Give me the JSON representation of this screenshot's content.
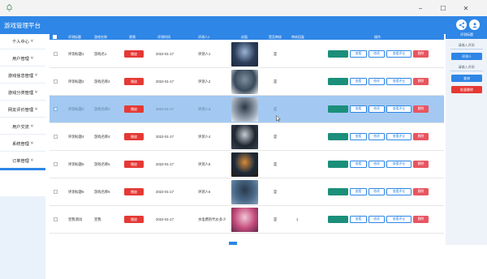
{
  "window": {
    "minimize": "−",
    "maximize": "☐",
    "close": "✕"
  },
  "header": {
    "title": "游戏管理平台"
  },
  "sidebar": {
    "items": [
      {
        "label": "个人中心",
        "arrow": "˅"
      },
      {
        "label": "用户管理",
        "arrow": "˅"
      },
      {
        "label": "游戏信息管理",
        "arrow": "˅"
      },
      {
        "label": "游戏分类管理",
        "arrow": "˅"
      },
      {
        "label": "网友评价管理",
        "arrow": "˅"
      },
      {
        "label": "用户交流",
        "arrow": "˅"
      },
      {
        "label": "系统管理",
        "arrow": "˅"
      },
      {
        "label": "订单管理",
        "arrow": "˅"
      }
    ]
  },
  "table": {
    "columns": [
      "评测标题",
      "游戏名称",
      "视频",
      "评测时间",
      "评测人2",
      "封面",
      "是否审核",
      "审核回复",
      "操作"
    ],
    "rows": [
      {
        "title": "评测标题1",
        "game": "游戏名1",
        "video": "播放",
        "date": "2022-01-17",
        "reviewer": "评测人1",
        "audit": "是",
        "reply": "",
        "cover_colors": [
          "#2b3d5a",
          "#9bb4d6",
          "#1d2738"
        ]
      },
      {
        "title": "评测标题2",
        "game": "游戏名称2",
        "video": "播放",
        "date": "2022-01-17",
        "reviewer": "评测人2",
        "audit": "是",
        "reply": "",
        "cover_colors": [
          "#394a5c",
          "#7d8e9e",
          "#f0f0f0"
        ]
      },
      {
        "title": "评测标题3",
        "game": "游戏名称3",
        "video": "播放",
        "date": "2022-01-17",
        "reviewer": "评测人3",
        "audit": "是",
        "reply": "",
        "cover_colors": [
          "#8e9aa8",
          "#2c3846",
          "#e6ebf2"
        ]
      },
      {
        "title": "评测标题4",
        "game": "游戏名称4",
        "video": "播放",
        "date": "2022-01-17",
        "reviewer": "评测人4",
        "audit": "是",
        "reply": "",
        "cover_colors": [
          "#1e2630",
          "#c8cdd4",
          "#3a4452"
        ]
      },
      {
        "title": "评测标题5",
        "game": "游戏名称5",
        "video": "播放",
        "date": "2022-01-17",
        "reviewer": "评测人5",
        "audit": "是",
        "reply": "",
        "cover_colors": [
          "#1a2a3a",
          "#d98a3a",
          "#2a1a12"
        ]
      },
      {
        "title": "评测标题6",
        "game": "游戏名称6",
        "video": "播放",
        "date": "2022-01-17",
        "reviewer": "评测人6",
        "audit": "是",
        "reply": "",
        "cover_colors": [
          "#4a6a8a",
          "#2a3a4a",
          "#8aa2ba"
        ]
      },
      {
        "title": "宣我测试",
        "game": "宣我",
        "video": "播放",
        "date": "2022-01-17",
        "reviewer": "水电费的代价多少",
        "audit": "是",
        "reply": "1",
        "cover_colors": [
          "#c24a7a",
          "#f2c6d6",
          "#5a2a4a"
        ]
      }
    ],
    "ops": {
      "view": "查看",
      "edit": "修改",
      "comments": "查看评论",
      "delete": "删除"
    }
  },
  "right_panel": {
    "top_button": "评测标题",
    "input_hint_1": "请输入评测",
    "button_reviewer": "评测人",
    "input_hint_2": "请输入评测",
    "query_button": "查询",
    "batch_delete_button": "批量删除"
  },
  "colors": {
    "primary": "#2e86e6",
    "danger": "#e53935",
    "teal": "#1b8f7a",
    "selected_row": "#a3c9f2"
  }
}
